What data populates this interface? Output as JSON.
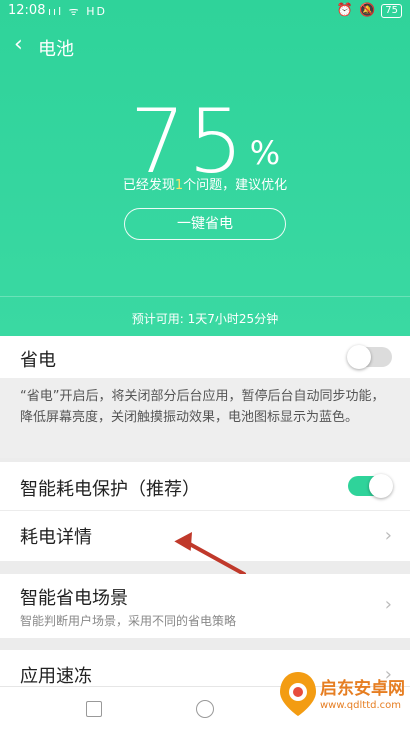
{
  "status_bar": {
    "time": "12:08",
    "signal": "ııl ᯤ HD",
    "battery": "75"
  },
  "header": {
    "title": "电池"
  },
  "battery": {
    "percent": "75",
    "unit": "%",
    "issue_prefix": "已经发现",
    "issue_count": "1",
    "issue_suffix": "个问题，建议优化",
    "save_button": "一键省电",
    "estimate": "预计可用: 1天7小时25分钟"
  },
  "settings": {
    "power_save": {
      "label": "省电",
      "enabled": false
    },
    "power_save_desc": "“省电”开启后，将关闭部分后台应用，暂停后台自动同步功能，降低屏幕亮度，关闭触摸振动效果，电池图标显示为蓝色。",
    "smart_protect": {
      "label": "智能耗电保护（推荐）",
      "enabled": true
    },
    "usage_details": {
      "label": "耗电详情"
    },
    "smart_scene": {
      "label": "智能省电场景",
      "sub": "智能判断用户场景，采用不同的省电策略"
    },
    "app_freeze": {
      "label": "应用速冻"
    }
  },
  "watermark": {
    "name": "启东安卓网",
    "url": "www.qdlttd.com"
  },
  "colors": {
    "accent": "#2fd39a",
    "toggle_on": "#2fd39a",
    "toggle_off": "#dcdcdc",
    "arrow": "#c0392b"
  }
}
